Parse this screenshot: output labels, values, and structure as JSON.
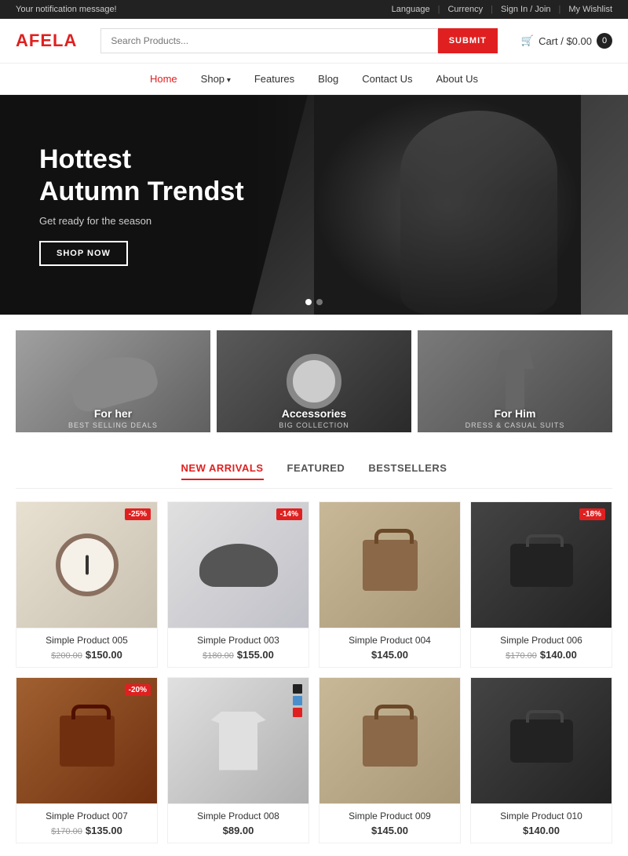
{
  "notification": {
    "message": "Your notification message!"
  },
  "topbar": {
    "language": "Language",
    "currency": "Currency",
    "sign_in": "Sign In / Join",
    "wishlist": "My Wishlist"
  },
  "header": {
    "logo_prefix": "A",
    "logo_name": "FELA",
    "search_placeholder": "Search Products...",
    "search_button": "SUBMIT",
    "cart_label": "Cart / $0.00",
    "cart_count": "0"
  },
  "nav": {
    "items": [
      {
        "label": "Home",
        "active": true,
        "dropdown": false
      },
      {
        "label": "Shop",
        "active": false,
        "dropdown": true
      },
      {
        "label": "Features",
        "active": false,
        "dropdown": false
      },
      {
        "label": "Blog",
        "active": false,
        "dropdown": false
      },
      {
        "label": "Contact Us",
        "active": false,
        "dropdown": false
      },
      {
        "label": "About Us",
        "active": false,
        "dropdown": false
      }
    ]
  },
  "hero": {
    "headline1": "Hottest",
    "headline2": "Autumn Trendst",
    "subtitle": "Get ready for the season",
    "button_label": "SHOP NOW",
    "slides": 2
  },
  "categories": [
    {
      "id": 1,
      "label": "For her",
      "sub": "BEST SELLING DEALS"
    },
    {
      "id": 2,
      "label": "Accessories",
      "sub": "BIG COLLECTION"
    },
    {
      "id": 3,
      "label": "For Him",
      "sub": "DRESS & CASUAL SUITS"
    }
  ],
  "product_tabs": [
    {
      "label": "NEW ARRIVALS",
      "active": true
    },
    {
      "label": "FEATURED",
      "active": false
    },
    {
      "label": "BESTSELLERS",
      "active": false
    }
  ],
  "products": [
    {
      "id": 1,
      "name": "Simple Product 005",
      "price": "$150.00",
      "original_price": "$200.00",
      "discount": "-25%",
      "type": "watch"
    },
    {
      "id": 2,
      "name": "Simple Product 003",
      "price": "$155.00",
      "original_price": "$180.00",
      "discount": "-14%",
      "type": "shoe"
    },
    {
      "id": 3,
      "name": "Simple Product 004",
      "price": "$145.00",
      "original_price": null,
      "discount": null,
      "type": "bag"
    },
    {
      "id": 4,
      "name": "Simple Product 006",
      "price": "$140.00",
      "original_price": "$170.00",
      "discount": "-18%",
      "type": "black-bag"
    },
    {
      "id": 5,
      "name": "Simple Product 007",
      "price": "$135.00",
      "original_price": "$170.00",
      "discount": "-20%",
      "type": "brown-bag"
    },
    {
      "id": 6,
      "name": "Simple Product 008",
      "price": "$89.00",
      "original_price": null,
      "discount": null,
      "type": "polo",
      "colors": [
        "#222",
        "#4a8fcc",
        "#e02020"
      ]
    },
    {
      "id": 7,
      "name": "Simple Product 009",
      "price": "$145.00",
      "original_price": null,
      "discount": null,
      "type": "bag"
    },
    {
      "id": 8,
      "name": "Simple Product 010",
      "price": "$140.00",
      "original_price": null,
      "discount": null,
      "type": "black-bag"
    }
  ]
}
